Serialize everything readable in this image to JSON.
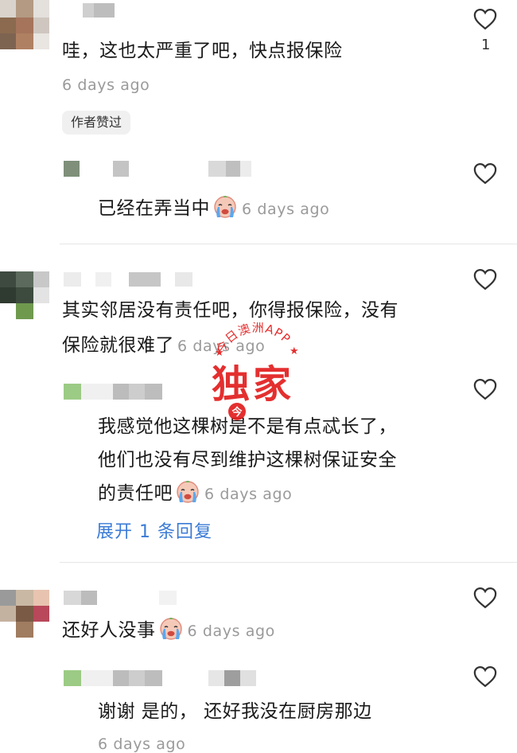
{
  "comments": [
    {
      "text": "哇，这也太严重了吧，快点报保险",
      "time": "6 days ago",
      "like_count": "1",
      "badge": "作者赞过",
      "reply": {
        "text": "已经在弄当中",
        "time": "6 days ago",
        "emoji": "crying-face"
      }
    },
    {
      "text_line1": "其实邻居没有责任吧，你得报保险，没有",
      "text_line2": "保险就很难了",
      "time": "6 days ago",
      "reply": {
        "line1": "我感觉他这棵树是不是有点忒长了，",
        "line2": "他们也没有尽到维护这棵树保证安全",
        "line3": "的责任吧",
        "time": "6 days ago",
        "emoji": "crying-face"
      },
      "expand_label": "展开 1 条回复"
    },
    {
      "text": "还好人没事",
      "time": "6 days ago",
      "emoji": "crying-face",
      "reply": {
        "text": "谢谢 是的， 还好我没在厨房那边",
        "time": "6 days ago"
      }
    }
  ],
  "watermark": {
    "arc_text": "今日澳洲APP",
    "main_text": "独家",
    "logo_char": "今"
  },
  "colors": {
    "link": "#3b7bd6",
    "time": "#9a9a9a",
    "watermark": "#e21e1e"
  }
}
